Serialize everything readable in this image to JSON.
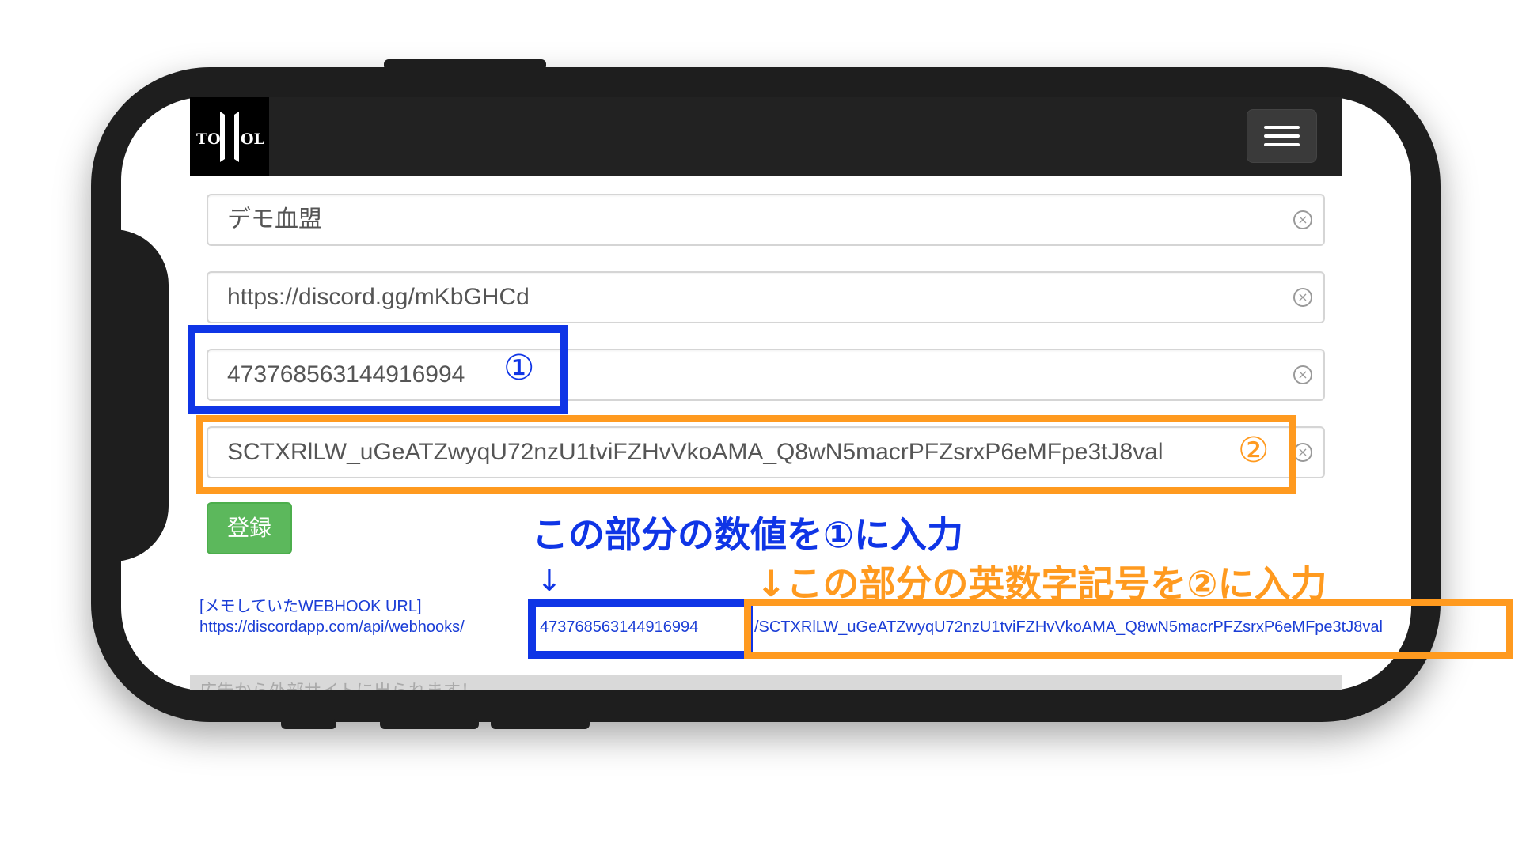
{
  "header": {
    "logo_text_left": "TO",
    "logo_text_right": "OL"
  },
  "form": {
    "fields": [
      {
        "value": "デモ血盟"
      },
      {
        "value": "https://discord.gg/mKbGHCd"
      },
      {
        "value": "473768563144916994"
      },
      {
        "value": "SCTXRlLW_uGeATZwyqU72nzU1tviFZHvVkoAMA_Q8wN5macrPFZsrxP6eMFpe3tJ8val"
      }
    ],
    "submit_label": "登録"
  },
  "memo": {
    "label": "[メモしていたWEBHOOK URL]",
    "url_prefix": "https://discordapp.com/api/webhooks/",
    "url_id": "473768563144916994",
    "url_token": "/SCTXRlLW_uGeATZwyqU72nzU1tviFZHvVkoAMA_Q8wN5macrPFZsrxP6eMFpe3tJ8val"
  },
  "ad_notice": "広告から外部サイトに出られます！",
  "annotations": {
    "badge_1": "①",
    "badge_2": "②",
    "instruction_1": "この部分の数値を①に入力",
    "instruction_2": "↓この部分の英数字記号を②に入力",
    "arrow_1": "↓"
  },
  "colors": {
    "annotation_blue": "#0f35e6",
    "annotation_orange": "#ff9a1f",
    "button_green": "#5cb85c",
    "link_blue": "#1a3dd6"
  }
}
